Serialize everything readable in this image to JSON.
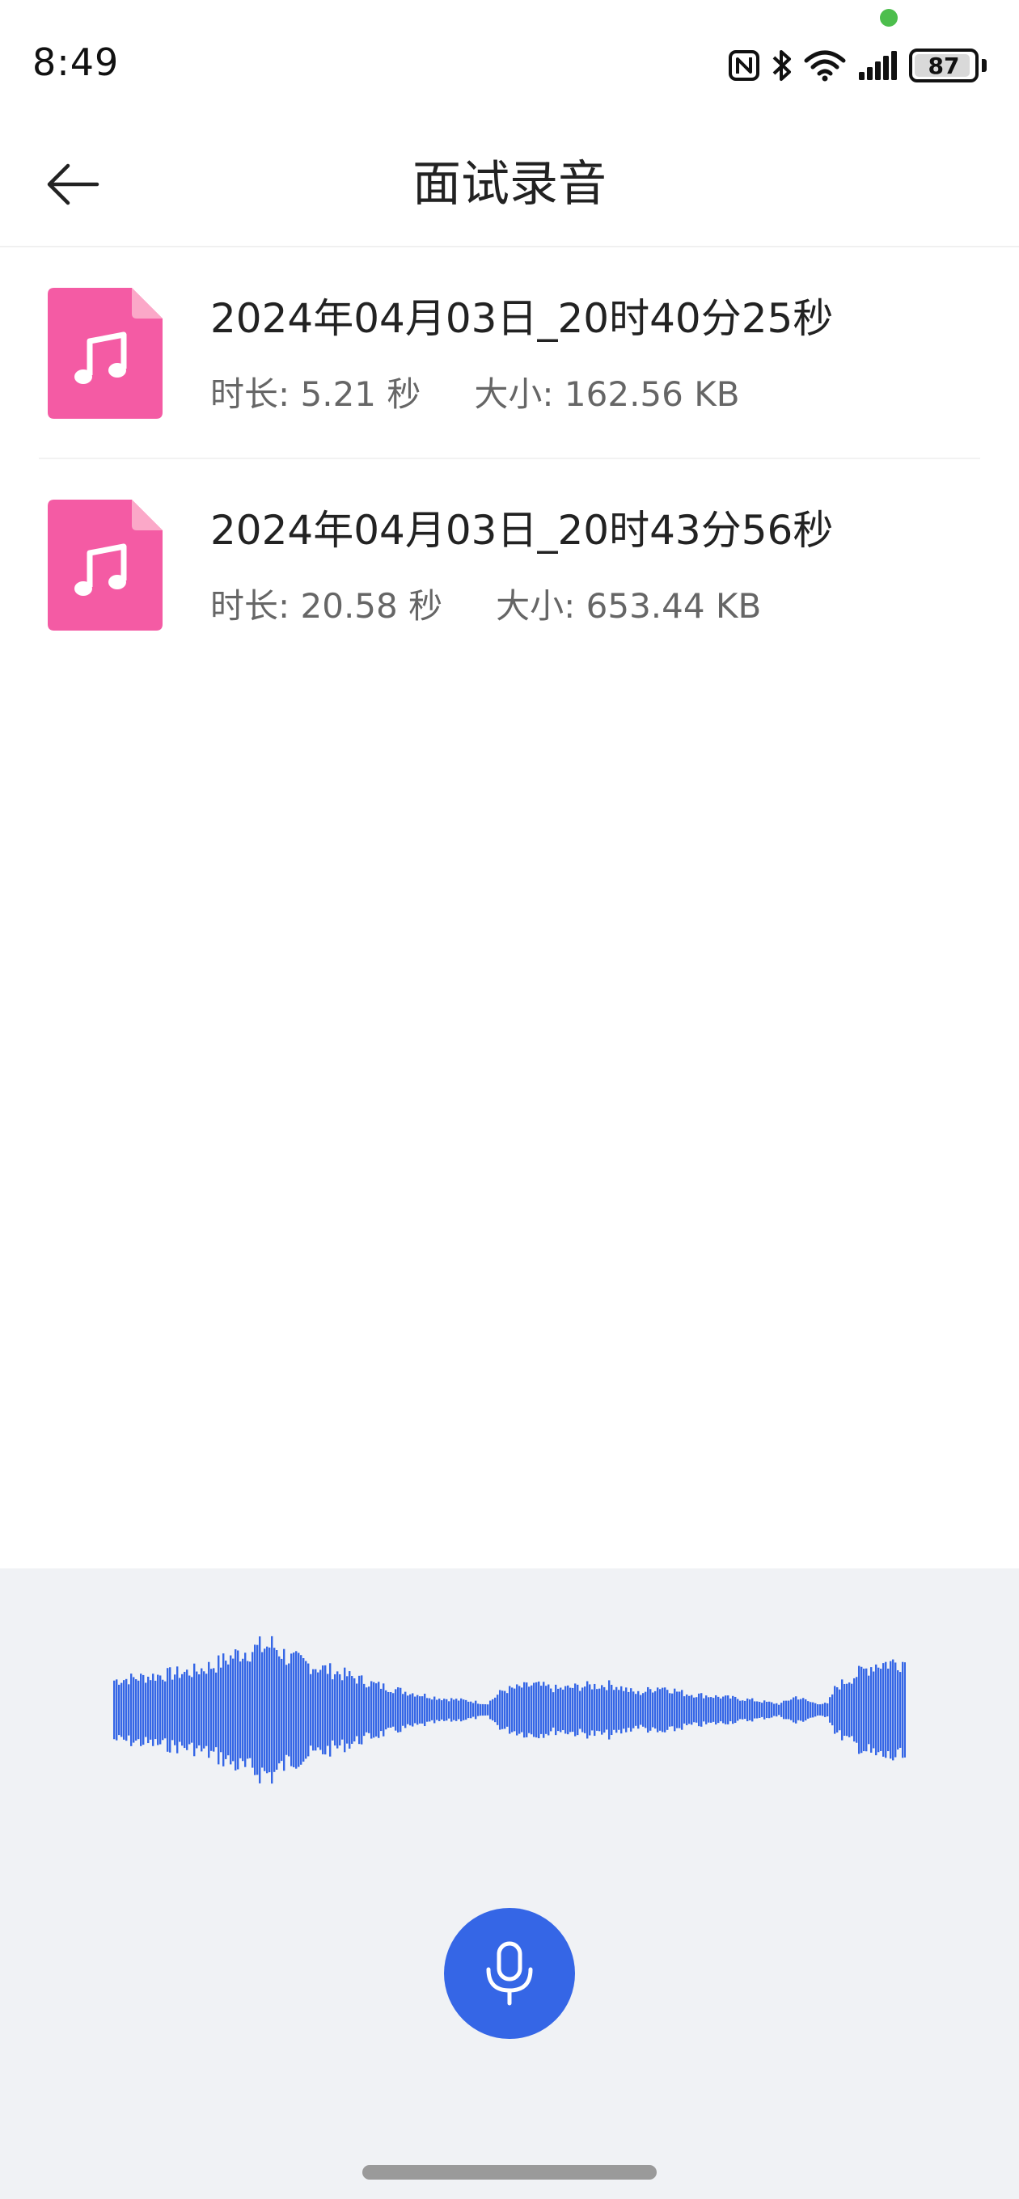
{
  "status_bar": {
    "time": "8:49",
    "battery_level": "87",
    "icons": [
      "nfc-icon",
      "bluetooth-icon",
      "wifi-icon",
      "signal-icon",
      "battery-icon"
    ]
  },
  "header": {
    "title": "面试录音",
    "back_icon": "arrow-left-icon"
  },
  "recordings": [
    {
      "name": "2024年04月03日_20时40分25秒",
      "duration_label": "时长:",
      "duration": "5.21 秒",
      "size_label": "大小:",
      "size": "162.56 KB",
      "icon": "music-file-icon"
    },
    {
      "name": "2024年04月03日_20时43分56秒",
      "duration_label": "时长:",
      "duration": "20.58 秒",
      "size_label": "大小:",
      "size": "653.44 KB",
      "icon": "music-file-icon"
    }
  ],
  "recorder": {
    "mic_icon": "microphone-icon"
  },
  "colors": {
    "accent": "#3566e6",
    "file_icon": "#f45ba4",
    "file_icon_fold": "#fba8c8",
    "panel_bg": "#f0f2f5",
    "waveform": "#3566e6"
  }
}
